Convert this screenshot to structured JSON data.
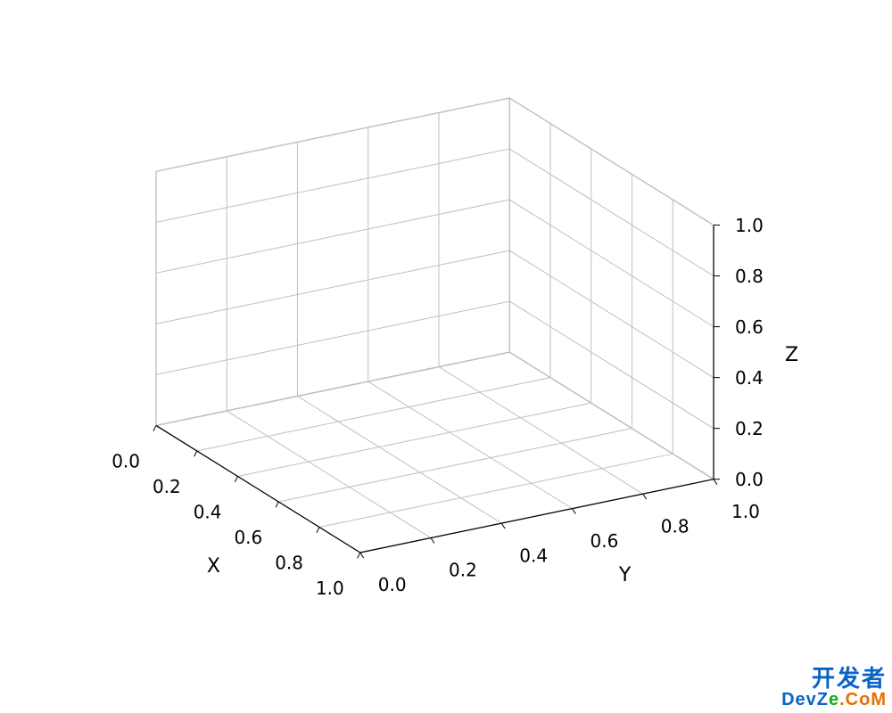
{
  "chart_data": {
    "type": "3d_axes",
    "title": "",
    "xlabel": "X",
    "ylabel": "Y",
    "zlabel": "Z",
    "xlim": [
      0.0,
      1.0
    ],
    "ylim": [
      0.0,
      1.0
    ],
    "zlim": [
      0.0,
      1.0
    ],
    "x_ticks": [
      0.0,
      0.2,
      0.4,
      0.6,
      0.8,
      1.0
    ],
    "y_ticks": [
      0.0,
      0.2,
      0.4,
      0.6,
      0.8,
      1.0
    ],
    "z_ticks": [
      0.0,
      0.2,
      0.4,
      0.6,
      0.8,
      1.0
    ],
    "x_tick_labels": [
      "0.0",
      "0.2",
      "0.4",
      "0.6",
      "0.8",
      "1.0"
    ],
    "y_tick_labels": [
      "0.0",
      "0.2",
      "0.4",
      "0.6",
      "0.8",
      "1.0"
    ],
    "z_tick_labels": [
      "0.0",
      "0.2",
      "0.4",
      "0.6",
      "0.8",
      "1.0"
    ],
    "series": []
  },
  "watermark": {
    "line1": "开发者",
    "line2_parts": [
      "DevZ",
      "e",
      ".CoM"
    ]
  }
}
